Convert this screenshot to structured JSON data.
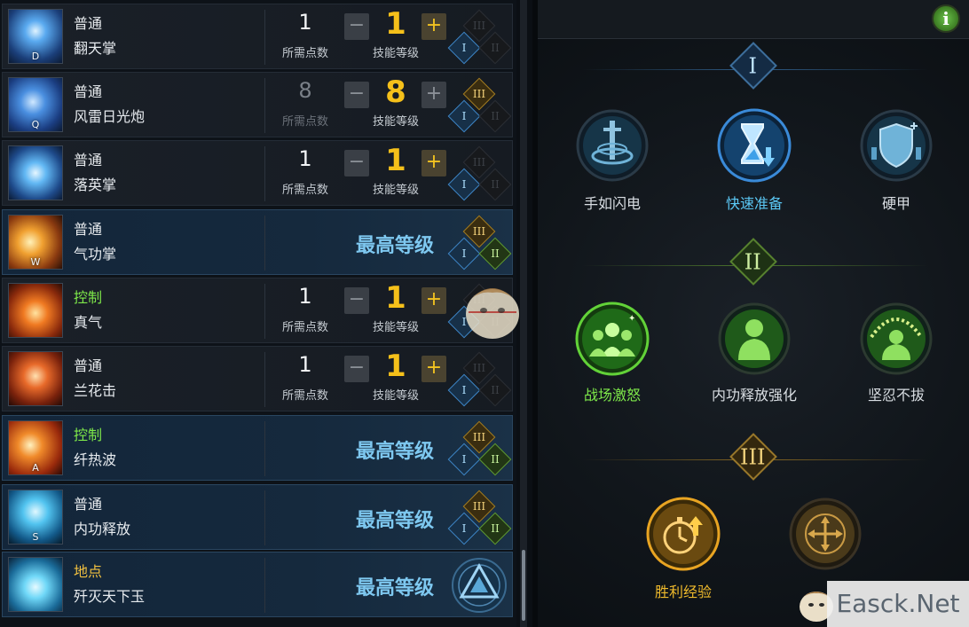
{
  "skills": [
    {
      "type": "普通",
      "name": "翻天掌",
      "key": "D",
      "state": "normal",
      "points": "1",
      "points_label": "所需点数",
      "level": "1",
      "level_label": "技能等级",
      "tiers": [
        false,
        true,
        false
      ],
      "plus_enabled": true
    },
    {
      "type": "普通",
      "name": "风雷日光炮",
      "key": "Q",
      "state": "normal",
      "points": "8",
      "points_label": "所需点数",
      "level": "8",
      "level_label": "技能等级",
      "tiers": [
        false,
        true,
        true
      ],
      "plus_enabled": false
    },
    {
      "type": "普通",
      "name": "落英掌",
      "key": "",
      "state": "normal",
      "points": "1",
      "points_label": "所需点数",
      "level": "1",
      "level_label": "技能等级",
      "tiers": [
        false,
        true,
        false
      ],
      "plus_enabled": true
    },
    {
      "type": "普通",
      "name": "气功掌",
      "key": "W",
      "state": "max",
      "max_label": "最高等级",
      "tiers": [
        true,
        true,
        true
      ]
    },
    {
      "type": "控制",
      "name": "真气",
      "key": "",
      "state": "normal",
      "points": "1",
      "points_label": "所需点数",
      "level": "1",
      "level_label": "技能等级",
      "tiers": [
        false,
        true,
        false
      ],
      "plus_enabled": true
    },
    {
      "type": "普通",
      "name": "兰花击",
      "key": "",
      "state": "normal",
      "points": "1",
      "points_label": "所需点数",
      "level": "1",
      "level_label": "技能等级",
      "tiers": [
        false,
        true,
        false
      ],
      "plus_enabled": true
    },
    {
      "type": "控制",
      "name": "纤热波",
      "key": "A",
      "state": "max",
      "max_label": "最高等级",
      "tiers": [
        true,
        true,
        true
      ]
    },
    {
      "type": "普通",
      "name": "内功释放",
      "key": "S",
      "state": "max",
      "max_label": "最高等级",
      "tiers": [
        true,
        true,
        true
      ]
    },
    {
      "type": "地点",
      "name": "歼灭天下玉",
      "key": "",
      "state": "ultimate",
      "max_label": "最高等级"
    }
  ],
  "talent_panel": {
    "info_label": "i",
    "tiers": [
      {
        "numeral": "I",
        "talents": [
          {
            "name": "手如闪电",
            "selected": false,
            "icon": "sword-vortex-icon"
          },
          {
            "name": "快速准备",
            "selected": true,
            "icon": "hourglass-icon"
          },
          {
            "name": "硬甲",
            "selected": false,
            "icon": "shield-icon"
          }
        ]
      },
      {
        "numeral": "II",
        "talents": [
          {
            "name": "战场激怒",
            "selected": true,
            "icon": "crowd-icon"
          },
          {
            "name": "内功释放强化",
            "selected": false,
            "icon": "figure-icon"
          },
          {
            "name": "坚忍不拔",
            "selected": false,
            "icon": "burst-figure-icon"
          }
        ]
      },
      {
        "numeral": "III",
        "talents": [
          {
            "name": "胜利经验",
            "selected": true,
            "icon": "stopwatch-icon"
          },
          {
            "name": "",
            "selected": false,
            "icon": "compass-arrows-icon"
          }
        ]
      }
    ]
  },
  "watermark": "Easck.Net",
  "colors": {
    "accent_gold": "#f5c01a",
    "accent_blue": "#5bc8f5",
    "accent_green": "#7ee84a",
    "max_blue": "#7ec8f0"
  }
}
